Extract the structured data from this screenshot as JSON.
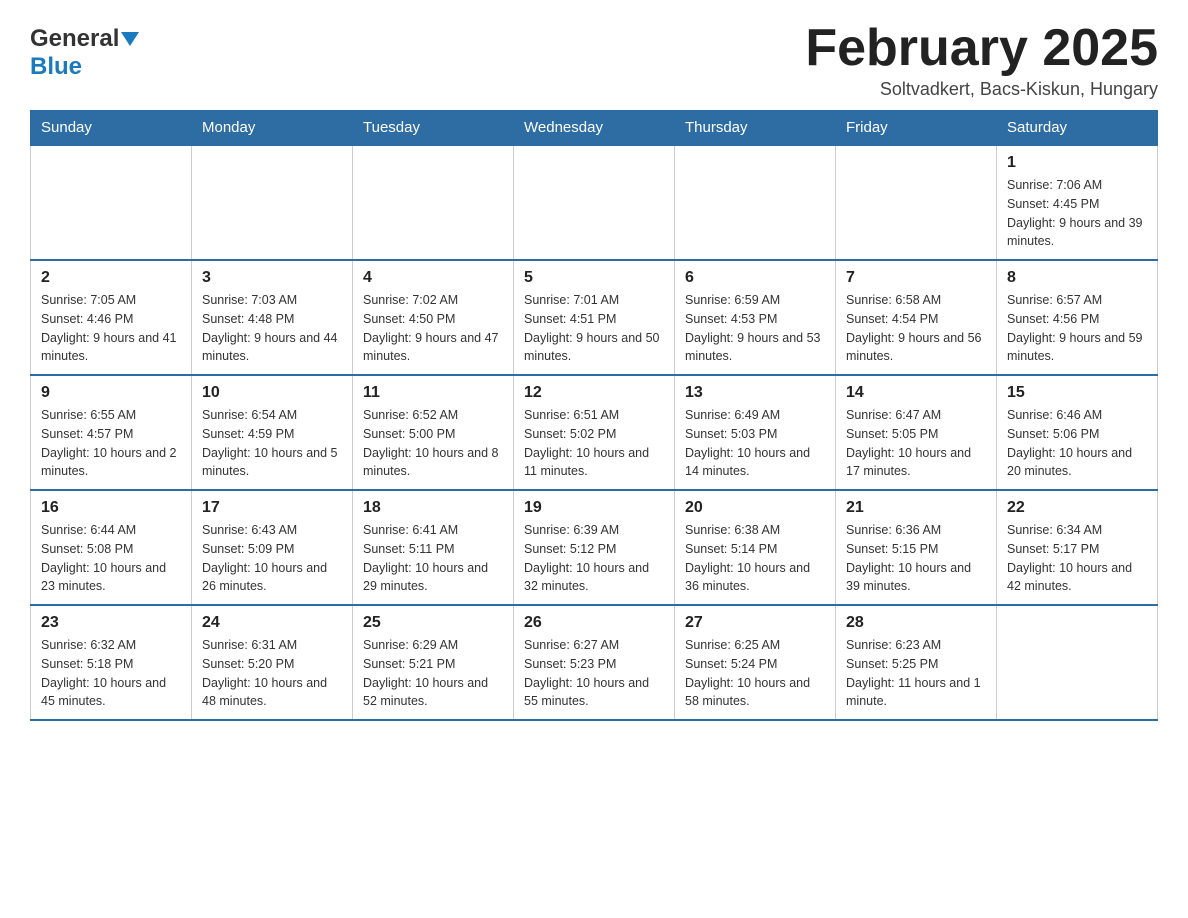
{
  "header": {
    "logo_general": "General",
    "logo_blue": "Blue",
    "month_title": "February 2025",
    "location": "Soltvadkert, Bacs-Kiskun, Hungary"
  },
  "days_of_week": [
    "Sunday",
    "Monday",
    "Tuesday",
    "Wednesday",
    "Thursday",
    "Friday",
    "Saturday"
  ],
  "weeks": [
    [
      {
        "day": "",
        "sunrise": "",
        "sunset": "",
        "daylight": ""
      },
      {
        "day": "",
        "sunrise": "",
        "sunset": "",
        "daylight": ""
      },
      {
        "day": "",
        "sunrise": "",
        "sunset": "",
        "daylight": ""
      },
      {
        "day": "",
        "sunrise": "",
        "sunset": "",
        "daylight": ""
      },
      {
        "day": "",
        "sunrise": "",
        "sunset": "",
        "daylight": ""
      },
      {
        "day": "",
        "sunrise": "",
        "sunset": "",
        "daylight": ""
      },
      {
        "day": "1",
        "sunrise": "Sunrise: 7:06 AM",
        "sunset": "Sunset: 4:45 PM",
        "daylight": "Daylight: 9 hours and 39 minutes."
      }
    ],
    [
      {
        "day": "2",
        "sunrise": "Sunrise: 7:05 AM",
        "sunset": "Sunset: 4:46 PM",
        "daylight": "Daylight: 9 hours and 41 minutes."
      },
      {
        "day": "3",
        "sunrise": "Sunrise: 7:03 AM",
        "sunset": "Sunset: 4:48 PM",
        "daylight": "Daylight: 9 hours and 44 minutes."
      },
      {
        "day": "4",
        "sunrise": "Sunrise: 7:02 AM",
        "sunset": "Sunset: 4:50 PM",
        "daylight": "Daylight: 9 hours and 47 minutes."
      },
      {
        "day": "5",
        "sunrise": "Sunrise: 7:01 AM",
        "sunset": "Sunset: 4:51 PM",
        "daylight": "Daylight: 9 hours and 50 minutes."
      },
      {
        "day": "6",
        "sunrise": "Sunrise: 6:59 AM",
        "sunset": "Sunset: 4:53 PM",
        "daylight": "Daylight: 9 hours and 53 minutes."
      },
      {
        "day": "7",
        "sunrise": "Sunrise: 6:58 AM",
        "sunset": "Sunset: 4:54 PM",
        "daylight": "Daylight: 9 hours and 56 minutes."
      },
      {
        "day": "8",
        "sunrise": "Sunrise: 6:57 AM",
        "sunset": "Sunset: 4:56 PM",
        "daylight": "Daylight: 9 hours and 59 minutes."
      }
    ],
    [
      {
        "day": "9",
        "sunrise": "Sunrise: 6:55 AM",
        "sunset": "Sunset: 4:57 PM",
        "daylight": "Daylight: 10 hours and 2 minutes."
      },
      {
        "day": "10",
        "sunrise": "Sunrise: 6:54 AM",
        "sunset": "Sunset: 4:59 PM",
        "daylight": "Daylight: 10 hours and 5 minutes."
      },
      {
        "day": "11",
        "sunrise": "Sunrise: 6:52 AM",
        "sunset": "Sunset: 5:00 PM",
        "daylight": "Daylight: 10 hours and 8 minutes."
      },
      {
        "day": "12",
        "sunrise": "Sunrise: 6:51 AM",
        "sunset": "Sunset: 5:02 PM",
        "daylight": "Daylight: 10 hours and 11 minutes."
      },
      {
        "day": "13",
        "sunrise": "Sunrise: 6:49 AM",
        "sunset": "Sunset: 5:03 PM",
        "daylight": "Daylight: 10 hours and 14 minutes."
      },
      {
        "day": "14",
        "sunrise": "Sunrise: 6:47 AM",
        "sunset": "Sunset: 5:05 PM",
        "daylight": "Daylight: 10 hours and 17 minutes."
      },
      {
        "day": "15",
        "sunrise": "Sunrise: 6:46 AM",
        "sunset": "Sunset: 5:06 PM",
        "daylight": "Daylight: 10 hours and 20 minutes."
      }
    ],
    [
      {
        "day": "16",
        "sunrise": "Sunrise: 6:44 AM",
        "sunset": "Sunset: 5:08 PM",
        "daylight": "Daylight: 10 hours and 23 minutes."
      },
      {
        "day": "17",
        "sunrise": "Sunrise: 6:43 AM",
        "sunset": "Sunset: 5:09 PM",
        "daylight": "Daylight: 10 hours and 26 minutes."
      },
      {
        "day": "18",
        "sunrise": "Sunrise: 6:41 AM",
        "sunset": "Sunset: 5:11 PM",
        "daylight": "Daylight: 10 hours and 29 minutes."
      },
      {
        "day": "19",
        "sunrise": "Sunrise: 6:39 AM",
        "sunset": "Sunset: 5:12 PM",
        "daylight": "Daylight: 10 hours and 32 minutes."
      },
      {
        "day": "20",
        "sunrise": "Sunrise: 6:38 AM",
        "sunset": "Sunset: 5:14 PM",
        "daylight": "Daylight: 10 hours and 36 minutes."
      },
      {
        "day": "21",
        "sunrise": "Sunrise: 6:36 AM",
        "sunset": "Sunset: 5:15 PM",
        "daylight": "Daylight: 10 hours and 39 minutes."
      },
      {
        "day": "22",
        "sunrise": "Sunrise: 6:34 AM",
        "sunset": "Sunset: 5:17 PM",
        "daylight": "Daylight: 10 hours and 42 minutes."
      }
    ],
    [
      {
        "day": "23",
        "sunrise": "Sunrise: 6:32 AM",
        "sunset": "Sunset: 5:18 PM",
        "daylight": "Daylight: 10 hours and 45 minutes."
      },
      {
        "day": "24",
        "sunrise": "Sunrise: 6:31 AM",
        "sunset": "Sunset: 5:20 PM",
        "daylight": "Daylight: 10 hours and 48 minutes."
      },
      {
        "day": "25",
        "sunrise": "Sunrise: 6:29 AM",
        "sunset": "Sunset: 5:21 PM",
        "daylight": "Daylight: 10 hours and 52 minutes."
      },
      {
        "day": "26",
        "sunrise": "Sunrise: 6:27 AM",
        "sunset": "Sunset: 5:23 PM",
        "daylight": "Daylight: 10 hours and 55 minutes."
      },
      {
        "day": "27",
        "sunrise": "Sunrise: 6:25 AM",
        "sunset": "Sunset: 5:24 PM",
        "daylight": "Daylight: 10 hours and 58 minutes."
      },
      {
        "day": "28",
        "sunrise": "Sunrise: 6:23 AM",
        "sunset": "Sunset: 5:25 PM",
        "daylight": "Daylight: 11 hours and 1 minute."
      },
      {
        "day": "",
        "sunrise": "",
        "sunset": "",
        "daylight": ""
      }
    ]
  ]
}
